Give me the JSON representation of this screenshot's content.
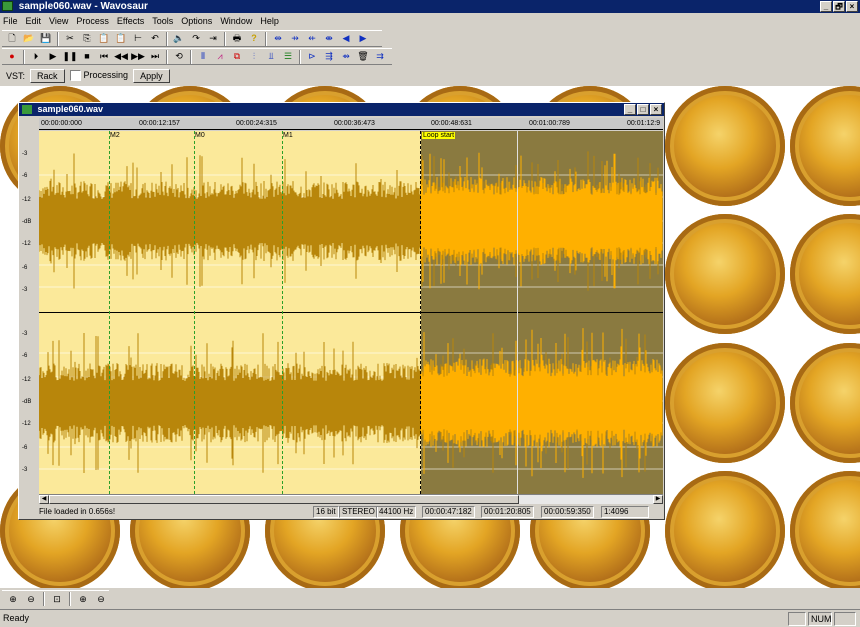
{
  "app": {
    "title": "sample060.wav - Wavosaur",
    "window_buttons": [
      "_",
      "🗗",
      "×"
    ]
  },
  "menu": [
    "File",
    "Edit",
    "View",
    "Process",
    "Effects",
    "Tools",
    "Options",
    "Window",
    "Help"
  ],
  "toolbar1": [
    "new-icon",
    "open-icon",
    "save-icon",
    "cut-icon",
    "copy-icon",
    "paste-icon",
    "paste-mix-icon",
    "trim-icon",
    "undo-icon",
    "mute-icon",
    "redo-icon",
    "crop-icon",
    "print-icon",
    "help-icon",
    "snap-left-icon",
    "snap-icon",
    "snap-right-icon",
    "snap-marker-icon",
    "prev-icon",
    "next-icon"
  ],
  "toolbar2": [
    "record-icon",
    "play-from-start-icon",
    "play-icon",
    "pause-icon",
    "stop-icon",
    "goto-start-icon",
    "rewind-icon",
    "fast-forward-icon",
    "goto-end-icon",
    "loop-icon",
    "mix-icon",
    "waveform-icon",
    "spectrum-icon",
    "effect-icon",
    "normalize-icon",
    "fade-icon",
    "marker-icon",
    "insert-icon",
    "marker-add-icon",
    "delete-icon",
    "export-icon"
  ],
  "vst": {
    "label": "VST:",
    "rack_button": "Rack",
    "processing_label": "Processing",
    "processing_checked": false,
    "apply_button": "Apply"
  },
  "doc": {
    "title": "sample060.wav",
    "ruler": [
      "00:00:00:000",
      "00:00:12:157",
      "00:00:24:315",
      "00:00:36:473",
      "00:00:48:631",
      "00:01:00:789",
      "00:01:12:9"
    ],
    "db_scale_top": [
      "-3",
      "-6",
      "-12",
      "-dB",
      "-12",
      "-6",
      "-3"
    ],
    "db_scale_bottom": [
      "-3",
      "-6",
      "-12",
      "-dB",
      "-12",
      "-6",
      "-3"
    ],
    "markers": [
      "M2",
      "M0",
      "M1"
    ],
    "loop_label": "Loop start",
    "status": {
      "message": "File loaded in 0.656s!",
      "bits": "16 bit",
      "channels": "STEREO",
      "rate": "44100 Hz",
      "time1": "00:00:47:182",
      "time2": "00:01:20:805",
      "time3": "00:00:59:350",
      "zoom": "1:4096"
    }
  },
  "zoom_tools": [
    "zoom-in-icon",
    "zoom-out-icon",
    "zoom-full-icon",
    "zoom-vert-in-icon",
    "zoom-vert-out-icon"
  ],
  "statusbar": {
    "text": "Ready",
    "num": "NUM"
  },
  "colors": {
    "wave_main": "#b8860b",
    "wave_loop": "#ffb000",
    "plot_bg": "#fbe99a",
    "loop_bg": "#8a7a40",
    "title_bg": "#0a246a"
  }
}
